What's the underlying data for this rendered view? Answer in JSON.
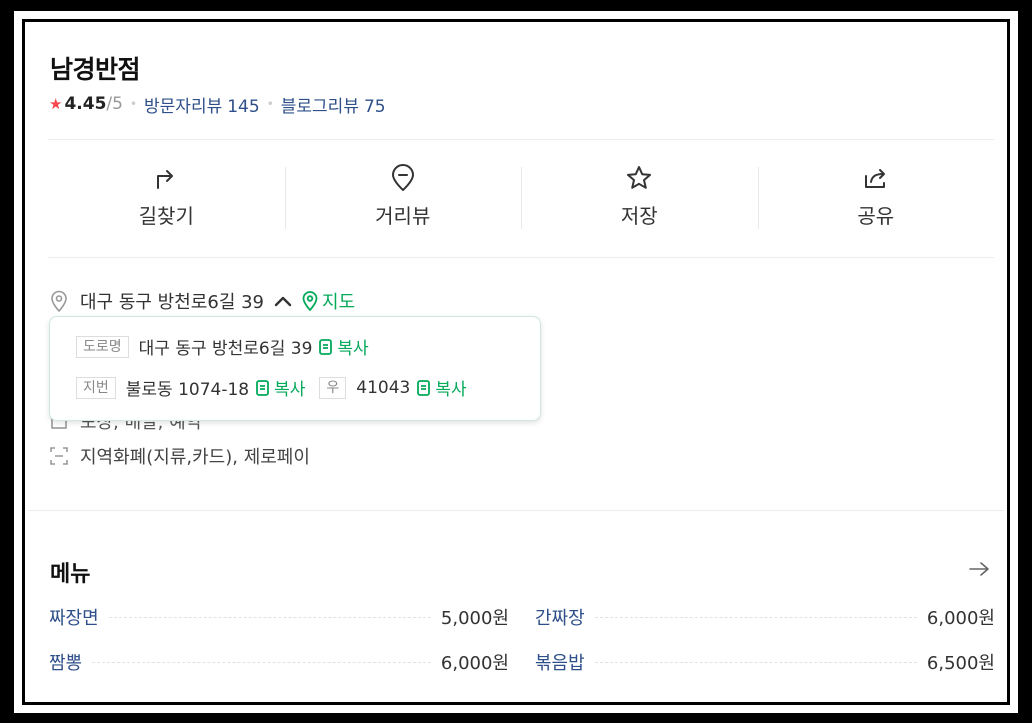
{
  "place": {
    "name": "남경반점",
    "rating": "4.45",
    "rating_max": "/5",
    "visitor_review_label": "방문자리뷰",
    "visitor_review_count": "145",
    "blog_review_label": "블로그리뷰",
    "blog_review_count": "75"
  },
  "actions": [
    {
      "label": "길찾기",
      "icon": "directions-icon"
    },
    {
      "label": "거리뷰",
      "icon": "street-view-pin-icon"
    },
    {
      "label": "저장",
      "icon": "star-outline-icon"
    },
    {
      "label": "공유",
      "icon": "share-icon"
    }
  ],
  "address": {
    "text": "대구 동구 방천로6길 39",
    "map_label": "지도",
    "popup": {
      "road_tag": "도로명",
      "road_address": "대구 동구 방천로6길 39",
      "copy_label": "복사",
      "lot_tag": "지번",
      "lot_address": "불로동 1074-18",
      "zip_tag": "우",
      "zip_code": "41043"
    }
  },
  "hidden_info": "포장, 배달, 예약",
  "payment": "지역화폐(지류,카드), 제로페이",
  "menu": {
    "title": "메뉴",
    "items": [
      {
        "name": "짜장면",
        "price": "5,000원"
      },
      {
        "name": "간짜장",
        "price": "6,000원"
      },
      {
        "name": "짬뽕",
        "price": "6,000원"
      },
      {
        "name": "볶음밥",
        "price": "6,500원"
      }
    ]
  },
  "colors": {
    "accent_green": "#03aa5a",
    "link_blue": "#2e4f8a",
    "star_red": "#f5464b"
  }
}
